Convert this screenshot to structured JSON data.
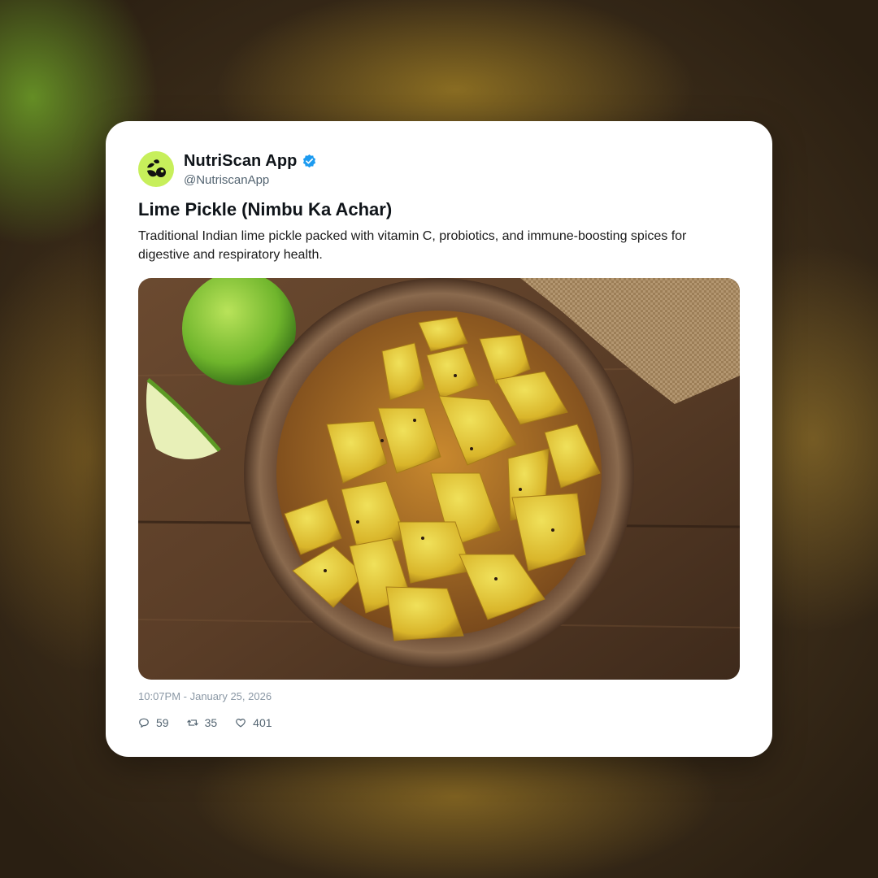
{
  "post": {
    "account": {
      "display_name": "NutriScan App",
      "handle": "@NutriscanApp",
      "verified": true,
      "avatar_icon": "nutriscan-logo-icon",
      "avatar_color": "#c7ef5b"
    },
    "title": "Lime Pickle (Nimbu Ka Achar)",
    "body": "Traditional Indian lime pickle packed with vitamin C, probiotics, and immune-boosting spices for digestive and respiratory health.",
    "timestamp": "10:07PM - January 25, 2026",
    "stats": {
      "replies": "59",
      "reposts": "35",
      "likes": "401"
    },
    "icons": {
      "reply": "reply-icon",
      "repost": "repost-icon",
      "like": "heart-icon",
      "verified": "verified-badge-icon"
    },
    "colors": {
      "verified_blue": "#1d9bf0",
      "text_primary": "#0f1419",
      "text_secondary": "#536471"
    }
  }
}
